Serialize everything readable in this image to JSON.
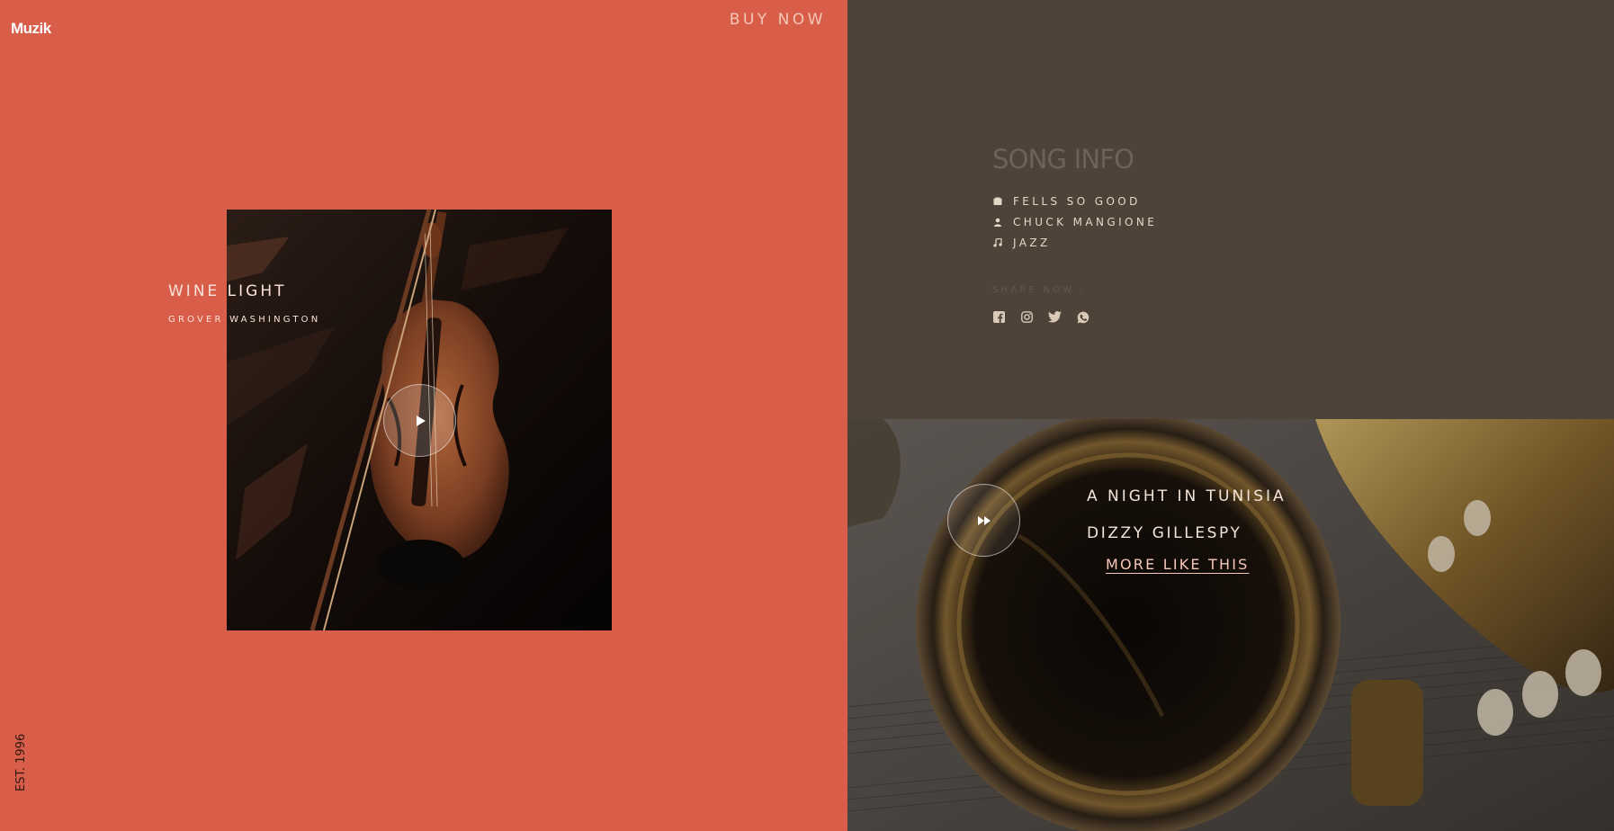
{
  "brand": "Muzik",
  "header": {
    "buy_now": "BUY NOW"
  },
  "featured": {
    "title": "WINE LIGHT",
    "artist": "GROVER WASHINGTON"
  },
  "footer": {
    "est": "EST. 1996"
  },
  "song_info": {
    "heading": "SONG INFO",
    "rows": [
      {
        "icon": "album-icon",
        "label": "FELLS SO GOOD"
      },
      {
        "icon": "person-icon",
        "label": "CHUCK MANGIONE"
      },
      {
        "icon": "music-note-icon",
        "label": "JAZZ"
      }
    ],
    "share_label": "SHARE NOW :",
    "socials": [
      "facebook-icon",
      "instagram-icon",
      "twitter-icon",
      "whatsapp-icon"
    ]
  },
  "now_playing": {
    "title": "A NIGHT IN TUNISIA",
    "artist": "DIZZY GILLESPY",
    "link": "MORE LIKE THIS"
  },
  "colors": {
    "left_bg": "#d95e4a",
    "right_bg": "#4d4338",
    "text_light": "#fbe3d9",
    "accent_link": "#f6c8b8"
  }
}
